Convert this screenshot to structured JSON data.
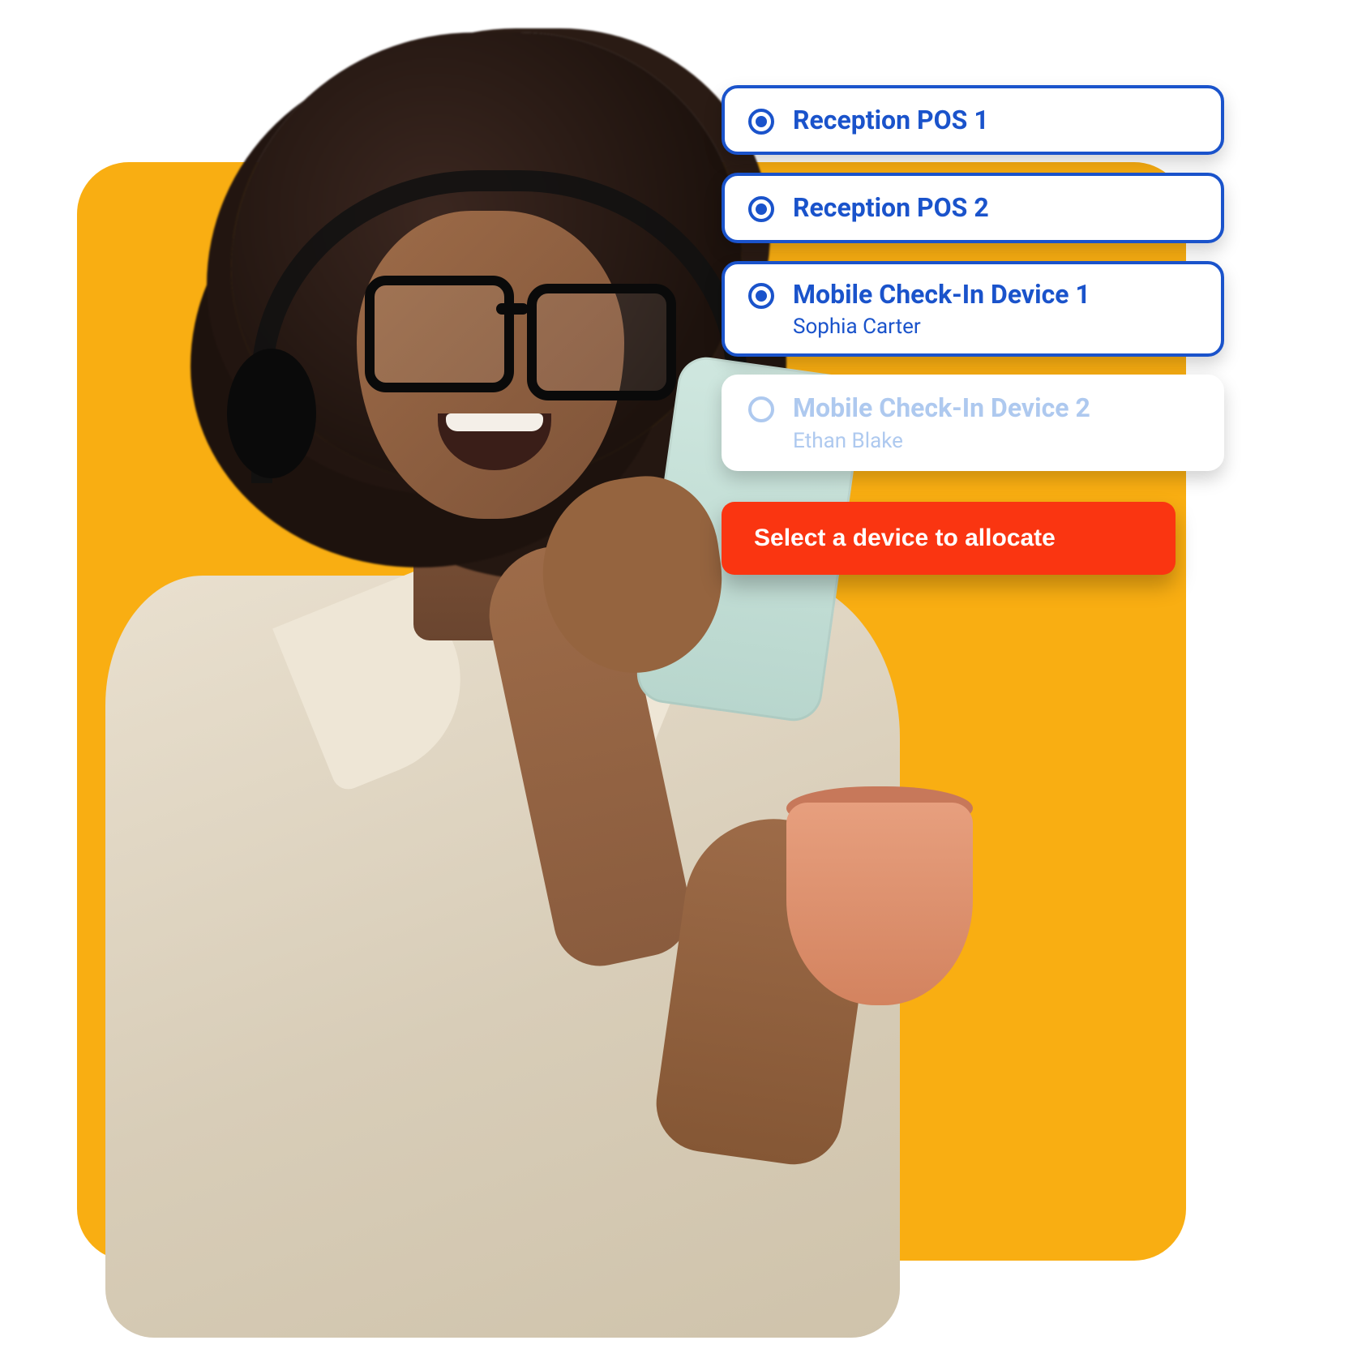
{
  "colors": {
    "accent_yellow": "#F9AE12",
    "primary_blue": "#1A53CB",
    "disabled_blue": "#AEC9EF",
    "cta_red": "#FA3511",
    "white": "#FFFFFF"
  },
  "devices": {
    "options": [
      {
        "label": "Reception POS 1",
        "sub": "",
        "selected": true
      },
      {
        "label": "Reception POS 2",
        "sub": "",
        "selected": true
      },
      {
        "label": "Mobile Check-In Device 1",
        "sub": "Sophia Carter",
        "selected": true
      },
      {
        "label": "Mobile Check-In Device 2",
        "sub": "Ethan Blake",
        "selected": false
      }
    ]
  },
  "cta_label": "Select a device to allocate"
}
